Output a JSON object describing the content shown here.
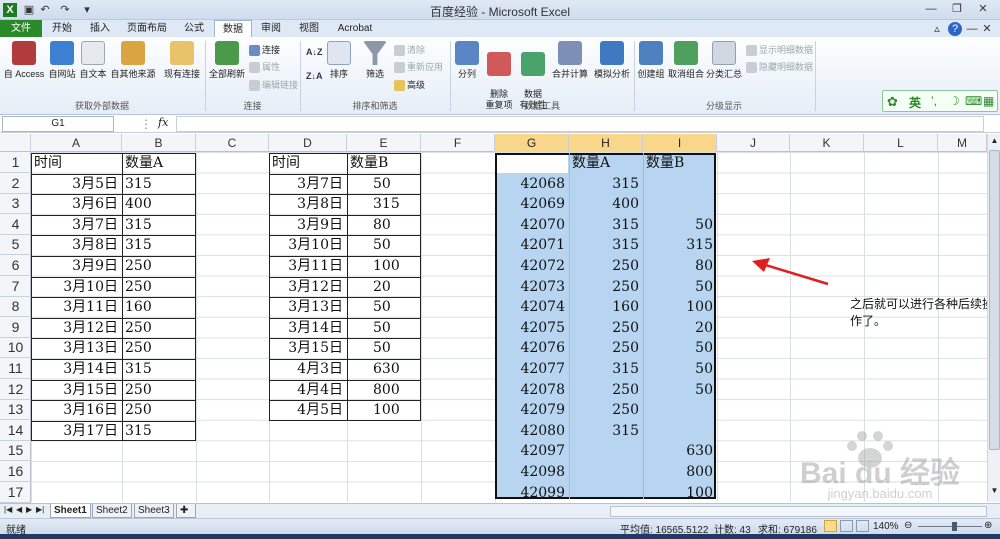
{
  "window": {
    "title": "百度经验 - Microsoft Excel",
    "controls": [
      "minimize-icon",
      "restore-icon",
      "close-icon"
    ]
  },
  "tabs": [
    "文件",
    "开始",
    "插入",
    "页面布局",
    "公式",
    "数据",
    "审阅",
    "视图",
    "Acrobat"
  ],
  "active_tab": "数据",
  "ribbon": {
    "groups": [
      {
        "label": "获取外部数据",
        "buttons": [
          "自 Access",
          "自网站",
          "自文本",
          "自其他来源",
          "现有连接"
        ]
      },
      {
        "label": "连接",
        "big": "全部刷新",
        "small": [
          "连接",
          "属性",
          "编辑链接"
        ]
      },
      {
        "label": "排序和筛选",
        "sort": "排序",
        "filter": "筛选",
        "small": [
          "清除",
          "重新应用",
          "高级"
        ]
      },
      {
        "label": "数据工具",
        "buttons": [
          "分列",
          "删除\n重复项",
          "数据\n有效性",
          "合并计算",
          "模拟分析"
        ]
      },
      {
        "label": "分级显示",
        "buttons": [
          "创建组",
          "取消组合",
          "分类汇总"
        ],
        "small": [
          "显示明细数据",
          "隐藏明细数据"
        ]
      }
    ],
    "ime": "英"
  },
  "formula_bar": {
    "name_box": "G1",
    "fx": "fx",
    "value": ""
  },
  "columns": [
    "A",
    "B",
    "C",
    "D",
    "E",
    "F",
    "G",
    "H",
    "I",
    "J",
    "K",
    "L",
    "M"
  ],
  "selected_columns": [
    "G",
    "H",
    "I"
  ],
  "rows": [
    "1",
    "2",
    "3",
    "4",
    "5",
    "6",
    "7",
    "8",
    "9",
    "10",
    "11",
    "12",
    "13",
    "14",
    "15",
    "16",
    "17"
  ],
  "table1": {
    "headers": [
      "时间",
      "数量A"
    ],
    "rows": [
      [
        "3月5日",
        "315"
      ],
      [
        "3月6日",
        "400"
      ],
      [
        "3月7日",
        "315"
      ],
      [
        "3月8日",
        "315"
      ],
      [
        "3月9日",
        "250"
      ],
      [
        "3月10日",
        "250"
      ],
      [
        "3月11日",
        "160"
      ],
      [
        "3月12日",
        "250"
      ],
      [
        "3月13日",
        "250"
      ],
      [
        "3月14日",
        "315"
      ],
      [
        "3月15日",
        "250"
      ],
      [
        "3月16日",
        "250"
      ],
      [
        "3月17日",
        "315"
      ]
    ]
  },
  "table2": {
    "headers": [
      "时间",
      "数量B"
    ],
    "rows": [
      [
        "3月7日",
        "50"
      ],
      [
        "3月8日",
        "315"
      ],
      [
        "3月9日",
        "80"
      ],
      [
        "3月10日",
        "50"
      ],
      [
        "3月11日",
        "100"
      ],
      [
        "3月12日",
        "20"
      ],
      [
        "3月13日",
        "50"
      ],
      [
        "3月14日",
        "50"
      ],
      [
        "3月15日",
        "50"
      ],
      [
        "4月3日",
        "630"
      ],
      [
        "4月4日",
        "800"
      ],
      [
        "4月5日",
        "100"
      ]
    ]
  },
  "table3": {
    "headers": [
      "",
      "数量A",
      "数量B"
    ],
    "rows": [
      [
        "42068",
        "315",
        ""
      ],
      [
        "42069",
        "400",
        ""
      ],
      [
        "42070",
        "315",
        "50"
      ],
      [
        "42071",
        "315",
        "315"
      ],
      [
        "42072",
        "250",
        "80"
      ],
      [
        "42073",
        "250",
        "50"
      ],
      [
        "42074",
        "160",
        "100"
      ],
      [
        "42075",
        "250",
        "20"
      ],
      [
        "42076",
        "250",
        "50"
      ],
      [
        "42077",
        "315",
        "50"
      ],
      [
        "42078",
        "250",
        "50"
      ],
      [
        "42079",
        "250",
        ""
      ],
      [
        "42080",
        "315",
        ""
      ],
      [
        "42097",
        "",
        "630"
      ],
      [
        "42098",
        "",
        "800"
      ],
      [
        "42099",
        "",
        "100"
      ]
    ]
  },
  "annotation": "之后就可以进行各种后续操作了。",
  "sheets": [
    "Sheet1",
    "Sheet2",
    "Sheet3"
  ],
  "status": {
    "mode": "就绪",
    "average": "平均值: 16565.5122",
    "count": "计数: 43",
    "sum": "求和: 679186",
    "zoom": "140%"
  },
  "watermark": {
    "brand": "Bai du 经验",
    "url": "jingyan.baidu.com"
  },
  "colors": {
    "selection": "#b7d5f0",
    "file_tab": "#2a8a2a",
    "arrow": "#e02020",
    "col_highlight": "#f8d78a"
  }
}
